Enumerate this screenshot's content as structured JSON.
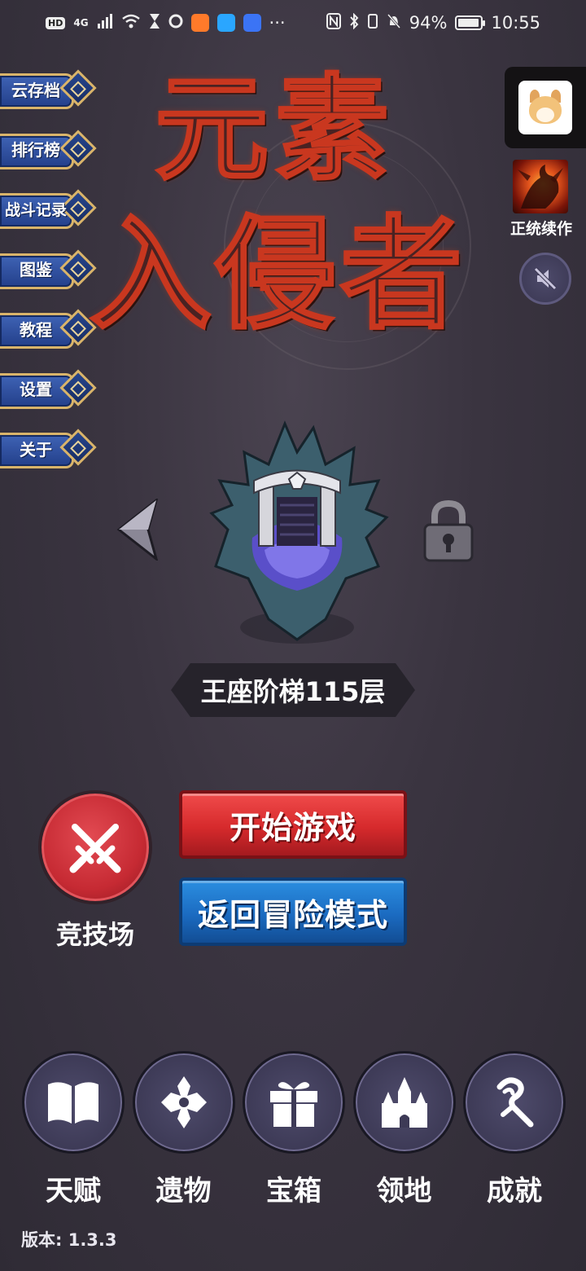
{
  "status_bar": {
    "hd": "HD",
    "network": "4G",
    "battery": "94%",
    "battery_level": 0.94,
    "time": "10:55",
    "more": "···"
  },
  "side_menu": [
    {
      "label": "云存档"
    },
    {
      "label": "排行榜"
    },
    {
      "label": "战斗记录"
    },
    {
      "label": "图鉴"
    },
    {
      "label": "教程"
    },
    {
      "label": "设置"
    },
    {
      "label": "关于"
    }
  ],
  "game_title": {
    "line1": "元素",
    "line2": "入侵者"
  },
  "right_panel": {
    "sequel_label": "正统续作",
    "mute_icon": "speaker-muted-icon"
  },
  "stage": {
    "name": "王座阶梯115层"
  },
  "actions": {
    "arena_label": "竞技场",
    "start_label": "开始游戏",
    "back_label": "返回冒险模式"
  },
  "bottom_nav": [
    {
      "label": "天赋",
      "icon": "book-icon"
    },
    {
      "label": "遗物",
      "icon": "cross-relic-icon"
    },
    {
      "label": "宝箱",
      "icon": "gift-box-icon"
    },
    {
      "label": "领地",
      "icon": "castle-icon"
    },
    {
      "label": "成就",
      "icon": "achievement-icon"
    }
  ],
  "version": "版本: 1.3.3",
  "colors": {
    "background": "#3a3440",
    "start_button": "#d62a2c",
    "back_button": "#1b6bc1",
    "menu_plate": "#2f4f9f",
    "menu_border": "#d9b46a",
    "title_red": "#c9371f"
  }
}
